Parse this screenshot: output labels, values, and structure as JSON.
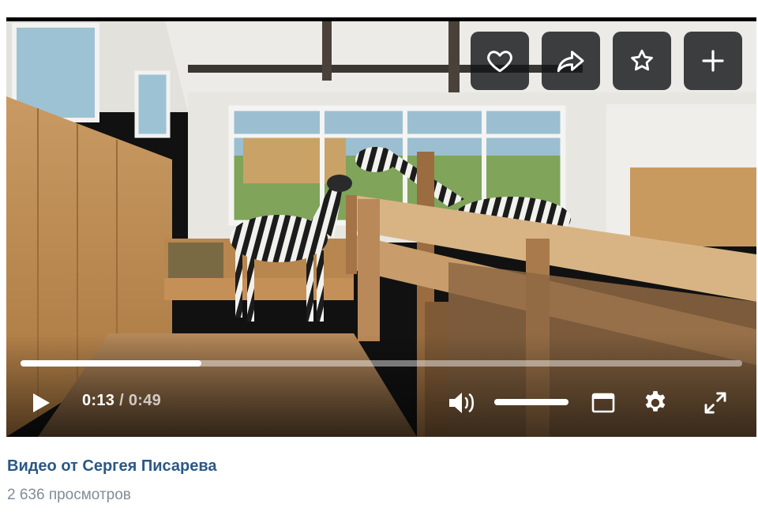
{
  "video": {
    "title": "Видео от Сергея Писарева",
    "views": "2 636 просмотров"
  },
  "player": {
    "current_time": "0:13",
    "separator": "/",
    "duration": "0:49",
    "progress_fraction": 0.25,
    "volume_fraction": 1.0
  },
  "top_actions": [
    {
      "icon": "heart-icon"
    },
    {
      "icon": "share-icon"
    },
    {
      "icon": "star-icon"
    },
    {
      "icon": "plus-icon"
    }
  ],
  "bottom_controls": {
    "play_icon": "play-icon",
    "volume_icon": "volume-icon",
    "miniplayer_icon": "miniplayer-icon",
    "settings_icon": "gear-icon",
    "fullscreen_icon": "fullscreen-icon"
  },
  "colors": {
    "title": "#2a5885",
    "views": "#818c99",
    "button_bg": "#14161a"
  }
}
